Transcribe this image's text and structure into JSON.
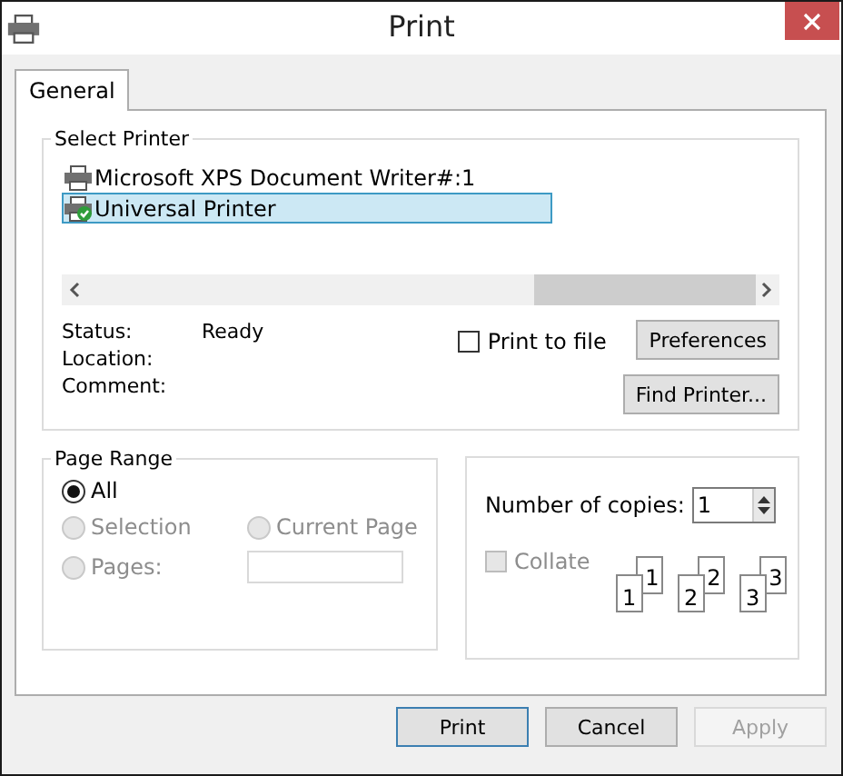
{
  "window": {
    "title": "Print"
  },
  "tabs": [
    {
      "label": "General",
      "selected": true
    }
  ],
  "select_printer": {
    "label": "Select Printer",
    "printers": [
      {
        "name": "Microsoft XPS Document Writer#:1",
        "selected": false,
        "default": false
      },
      {
        "name": "Universal Printer",
        "selected": true,
        "default": true
      }
    ],
    "details": [
      {
        "label": "Status:",
        "value": "Ready"
      },
      {
        "label": "Location:"
      },
      {
        "label": "Comment:"
      }
    ],
    "print_to_file": {
      "label": "Print to file",
      "checked": false
    },
    "buttons": [
      "Preferences",
      "Find Printer..."
    ]
  },
  "page_range": {
    "label": "Page Range",
    "options": [
      {
        "label": "All",
        "selected": true,
        "disabled": false
      },
      {
        "label": "Selection",
        "selected": false,
        "disabled": true
      },
      {
        "label": "Current Page",
        "selected": false,
        "disabled": true
      },
      {
        "label": "Pages:",
        "selected": false,
        "disabled": true
      }
    ]
  },
  "copies": {
    "label": "Number of copies:",
    "value": "1",
    "collate": {
      "label": "Collate",
      "checked": false,
      "disabled": true
    },
    "collate_sets": [
      {
        "front": "1",
        "back": "1"
      },
      {
        "front": "2",
        "back": "2"
      },
      {
        "front": "3",
        "back": "3"
      }
    ]
  },
  "buttons": [
    {
      "label": "Print",
      "default": true,
      "disabled": false
    },
    {
      "label": "Cancel",
      "default": false,
      "disabled": false
    },
    {
      "label": "Apply",
      "default": false,
      "disabled": true
    }
  ]
}
